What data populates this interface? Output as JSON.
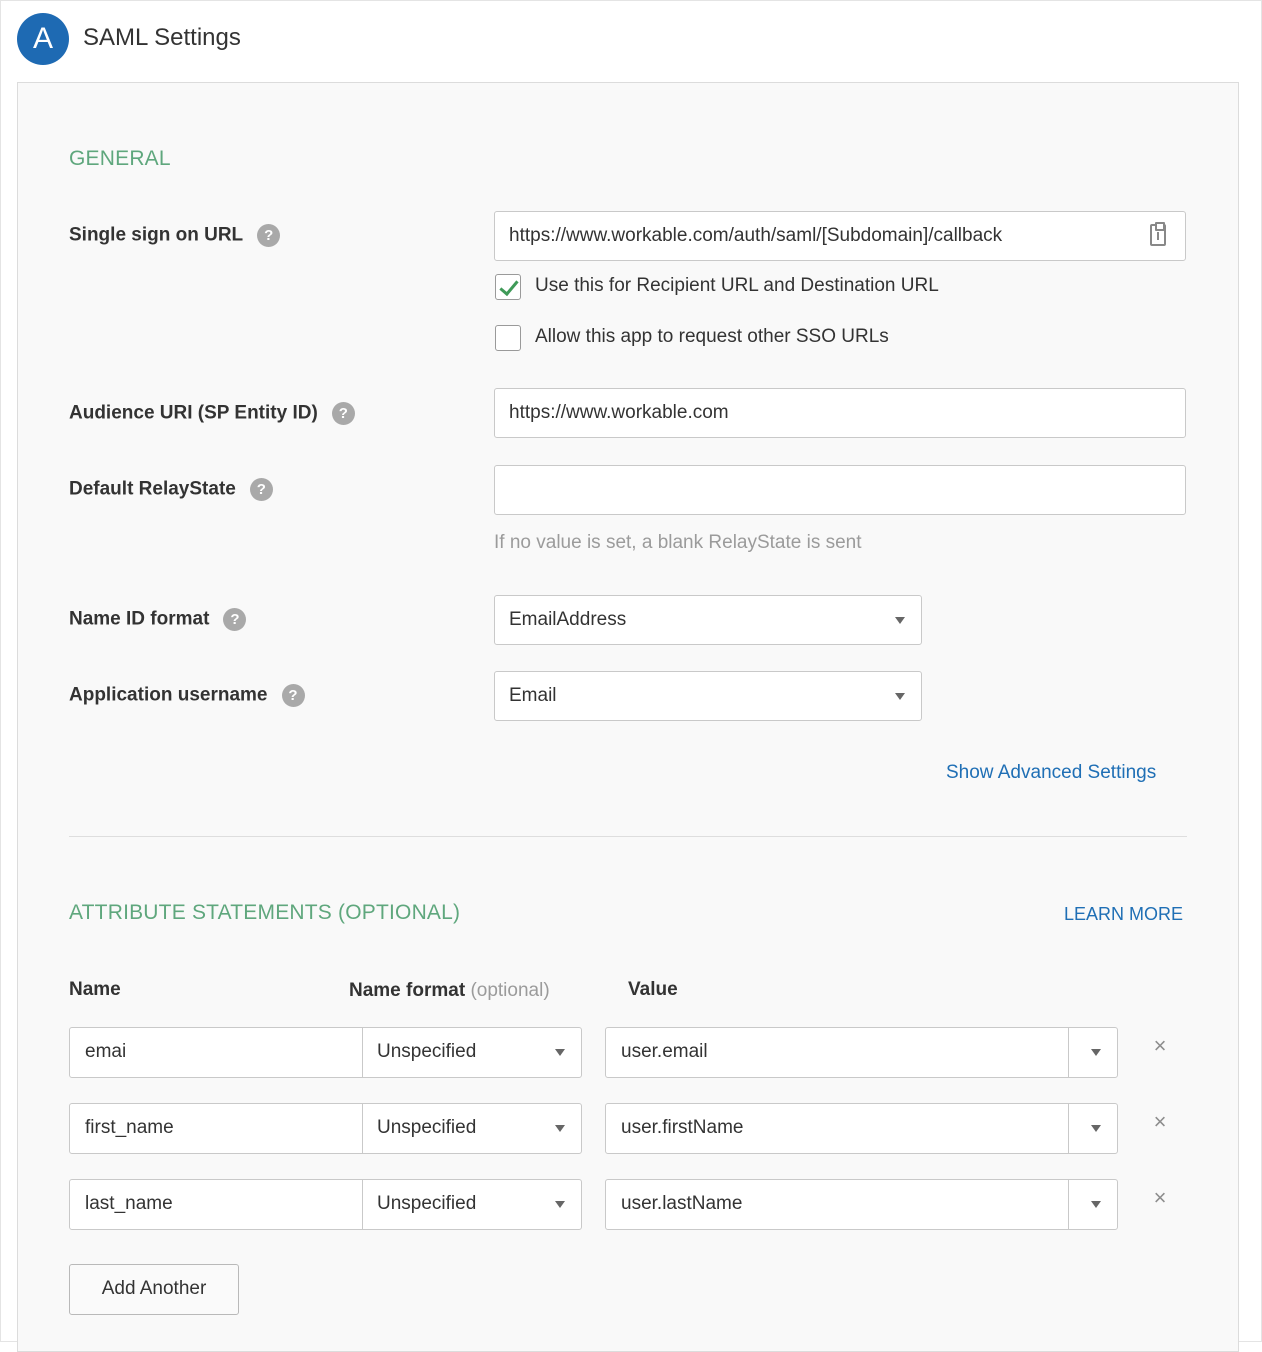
{
  "header": {
    "logo_letter": "A",
    "title": "SAML Settings"
  },
  "general": {
    "section_title": "GENERAL",
    "sso_url": {
      "label": "Single sign on URL",
      "value": "https://www.workable.com/auth/saml/[Subdomain]/callback",
      "checkbox_recipient": {
        "label": "Use this for Recipient URL and Destination URL",
        "checked": true
      },
      "checkbox_other_sso": {
        "label": "Allow this app to request other SSO URLs",
        "checked": false
      }
    },
    "audience_uri": {
      "label": "Audience URI (SP Entity ID)",
      "value": "https://www.workable.com"
    },
    "relay_state": {
      "label": "Default RelayState",
      "value": "",
      "hint": "If no value is set, a blank RelayState is sent"
    },
    "name_id_format": {
      "label": "Name ID format",
      "selected": "EmailAddress"
    },
    "app_username": {
      "label": "Application username",
      "selected": "Email"
    },
    "advanced_link": "Show Advanced Settings"
  },
  "attributes": {
    "section_title": "ATTRIBUTE STATEMENTS (OPTIONAL)",
    "learn_more": "LEARN MORE",
    "col_name": "Name",
    "col_format": "Name format",
    "col_format_optional": "(optional)",
    "col_value": "Value",
    "rows": [
      {
        "name": "emai",
        "format": "Unspecified",
        "value": "user.email"
      },
      {
        "name": "first_name",
        "format": "Unspecified",
        "value": "user.firstName"
      },
      {
        "name": "last_name",
        "format": "Unspecified",
        "value": "user.lastName"
      }
    ],
    "remove_symbol": "×",
    "add_button": "Add Another"
  },
  "colors": {
    "accent_green": "#5fa77d",
    "link_blue": "#1f6fb5",
    "logo_blue": "#1e6ab3",
    "check_green": "#3f9a58"
  },
  "icons": [
    "help-icon",
    "clipboard-icon",
    "checkmark-icon",
    "caret-down-icon",
    "remove-icon"
  ]
}
